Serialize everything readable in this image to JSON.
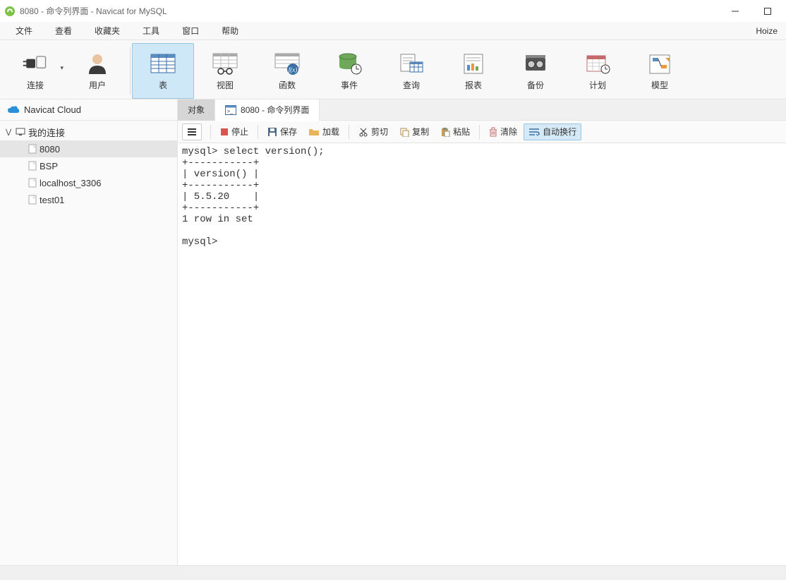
{
  "window": {
    "title": "8080 - 命令列界面 - Navicat for MySQL"
  },
  "menus": [
    "文件",
    "查看",
    "收藏夹",
    "工具",
    "窗口",
    "帮助"
  ],
  "right_label": "Hoize",
  "toolbar": {
    "connect": "连接",
    "user": "用户",
    "table": "表",
    "view": "视图",
    "function": "函数",
    "event": "事件",
    "query": "查询",
    "report": "报表",
    "backup": "备份",
    "schedule": "计划",
    "model": "模型"
  },
  "sidebar": {
    "cloud": "Navicat Cloud",
    "root": "我的连接",
    "items": [
      "8080",
      "BSP",
      "localhost_3306",
      "test01"
    ]
  },
  "tabs": {
    "objects": "对象",
    "console": "8080 - 命令列界面"
  },
  "editbar": {
    "stop": "停止",
    "save": "保存",
    "load": "加载",
    "cut": "剪切",
    "copy": "复制",
    "paste": "粘贴",
    "clear": "清除",
    "wrap": "自动换行"
  },
  "console_text": "mysql> select version();\n+-----------+\n| version() |\n+-----------+\n| 5.5.20    |\n+-----------+\n1 row in set\n\nmysql>"
}
